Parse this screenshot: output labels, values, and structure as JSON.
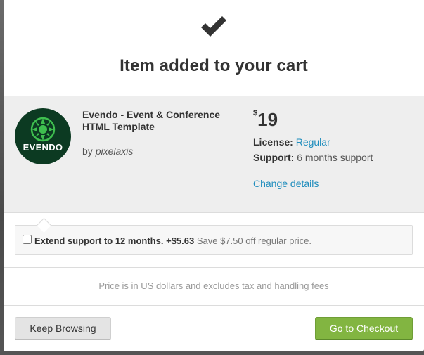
{
  "modal": {
    "title": "Item added to your cart",
    "check_icon": "checkmark-icon"
  },
  "item": {
    "logo_text": "EVENDO",
    "logo_colors": {
      "background": "#0c3a22",
      "mark": "#3fbf4f"
    },
    "name": "Evendo - Event & Conference HTML Template",
    "author_prefix": "by",
    "author": "pixelaxis",
    "currency_symbol": "$",
    "price": "19",
    "license_label": "License:",
    "license_value": "Regular",
    "support_label": "Support:",
    "support_value": "6 months support",
    "change_details": "Change details"
  },
  "extend": {
    "checked": false,
    "label": "Extend support to 12 months.",
    "price": "+$5.63",
    "note": "Save $7.50 off regular price."
  },
  "disclaimer": "Price is in US dollars and excludes tax and handling fees",
  "actions": {
    "keep_browsing": "Keep Browsing",
    "checkout": "Go to Checkout"
  },
  "colors": {
    "accent_link": "#1f8dbd",
    "checkout_button": "#82b541",
    "panel_background": "#eeeeee"
  }
}
